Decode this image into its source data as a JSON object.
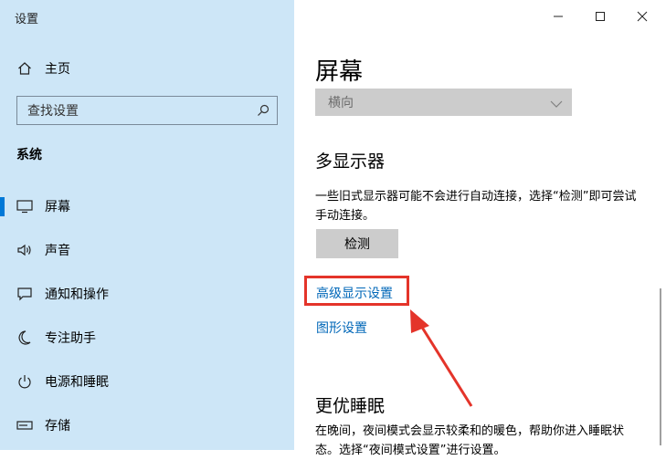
{
  "window": {
    "title": "设置",
    "controls": {
      "minimize": "minimize-icon",
      "maximize": "maximize-icon",
      "close": "close-icon"
    }
  },
  "sidebar": {
    "home_label": "主页",
    "search_placeholder": "查找设置",
    "section_label": "系统",
    "items": [
      {
        "label": "屏幕",
        "icon": "monitor-icon",
        "active": true
      },
      {
        "label": "声音",
        "icon": "speaker-icon"
      },
      {
        "label": "通知和操作",
        "icon": "notification-icon"
      },
      {
        "label": "专注助手",
        "icon": "moon-icon"
      },
      {
        "label": "电源和睡眠",
        "icon": "power-icon"
      },
      {
        "label": "存储",
        "icon": "storage-icon"
      }
    ]
  },
  "main": {
    "title": "屏幕",
    "orientation_value": "横向",
    "multi_display": {
      "heading": "多显示器",
      "description": "一些旧式显示器可能不会进行自动连接，选择“检测”即可尝试手动连接。",
      "detect_button": "检测"
    },
    "links": {
      "advanced": "高级显示设置",
      "graphics": "图形设置"
    },
    "night_light": {
      "heading": "更优睡眠",
      "description": "在晚间，夜间模式会显示较柔和的暖色，帮助你进入睡眠状态。选择“夜间模式设置”进行设置。"
    }
  },
  "colors": {
    "sidebar_bg": "#cde6f7",
    "accent": "#0078d7",
    "link": "#0067b8",
    "annotation_red": "#e4342a"
  }
}
